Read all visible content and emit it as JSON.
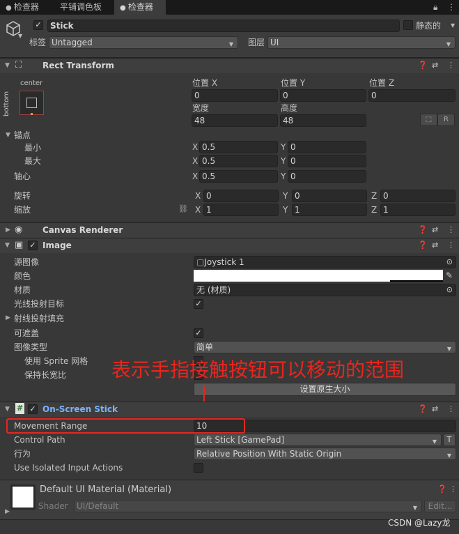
{
  "tabs": [
    {
      "label": "检查器"
    },
    {
      "label": "平铺调色板"
    },
    {
      "label": "检查器"
    }
  ],
  "object": {
    "name": "Stick",
    "static_label": "静态的",
    "tag_label": "标签",
    "tag_value": "Untagged",
    "layer_label": "图层",
    "layer_value": "UI"
  },
  "rect": {
    "title": "Rect Transform",
    "anchor_top": "center",
    "anchor_side": "bottom",
    "pos_x_label": "位置 X",
    "pos_y_label": "位置 Y",
    "pos_z_label": "位置 Z",
    "pos_x": "0",
    "pos_y": "0",
    "pos_z": "0",
    "width_label": "宽度",
    "height_label": "高度",
    "width": "48",
    "height": "48",
    "r_button": "R",
    "anchors_label": "锚点",
    "min_label": "最小",
    "max_label": "最大",
    "min_x": "0.5",
    "min_y": "0",
    "max_x": "0.5",
    "max_y": "0",
    "pivot_label": "轴心",
    "pivot_x": "0.5",
    "pivot_y": "0",
    "rotation_label": "旋转",
    "rot_x": "0",
    "rot_y": "0",
    "rot_z": "0",
    "scale_label": "缩放",
    "scale_x": "1",
    "scale_y": "1",
    "scale_z": "1",
    "x": "X",
    "y": "Y",
    "z": "Z"
  },
  "canvas_renderer": {
    "title": "Canvas Renderer"
  },
  "image": {
    "title": "Image",
    "source_label": "源图像",
    "source_value": "Joystick 1",
    "color_label": "颜色",
    "material_label": "材质",
    "material_value": "无 (材质)",
    "raycast_label": "光线投射目标",
    "raycast_padding_label": "射线投射填充",
    "maskable_label": "可遮盖",
    "image_type_label": "图像类型",
    "image_type_value": "简单",
    "sprite_mesh_label": "使用 Sprite 网格",
    "preserve_aspect_label": "保持长宽比",
    "native_size_button": "设置原生大小"
  },
  "annotation": {
    "text": "表示手指接触按钮可以移动的范围",
    "color": "#e8261e"
  },
  "stick": {
    "title": "On-Screen Stick",
    "movement_range_label": "Movement Range",
    "movement_range": "10",
    "control_path_label": "Control Path",
    "control_path": "Left Stick [GamePad]",
    "t_button": "T",
    "behavior_label": "行为",
    "behavior_value": "Relative Position With Static Origin",
    "isolated_label": "Use Isolated Input Actions"
  },
  "material": {
    "title": "Default UI Material (Material)",
    "shader_label": "Shader",
    "shader_value": "UI/Default",
    "edit_button": "Edit..."
  },
  "watermark": "CSDN @Lazy龙"
}
